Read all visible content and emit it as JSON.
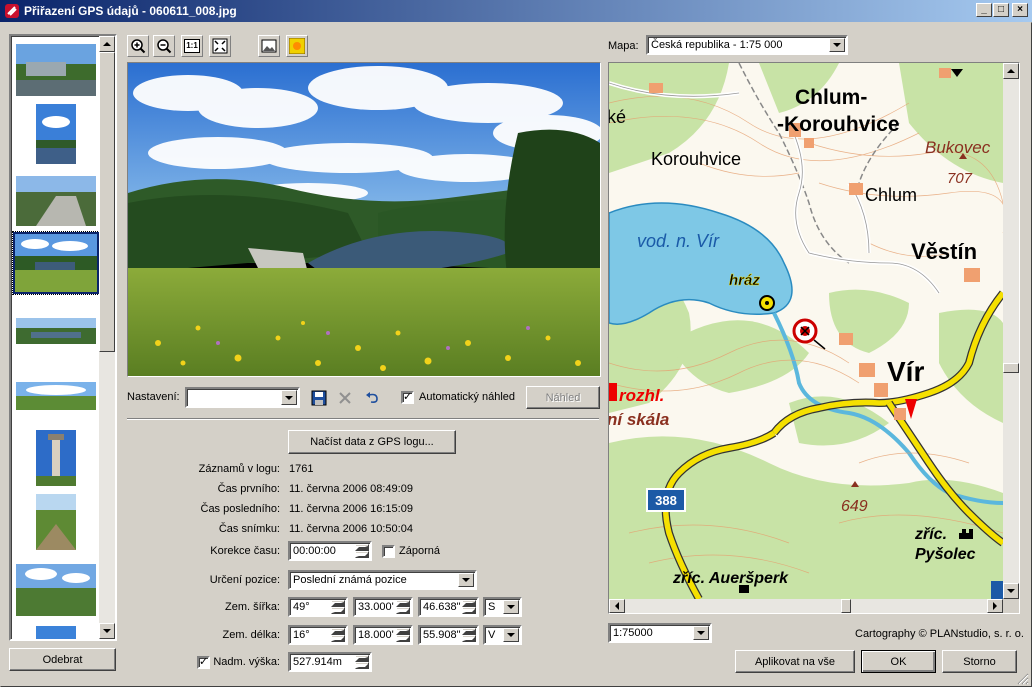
{
  "window": {
    "title": "Přiřazení GPS údajů - 060611_008.jpg",
    "min_label": "_",
    "max_label": "□",
    "close_label": "×"
  },
  "thumbnails": {
    "remove_button": "Odebrat"
  },
  "toolbar": {
    "zoom_in_icon": "zoom-in-icon",
    "zoom_out_icon": "zoom-out-icon",
    "actual_size_label": "1:1",
    "fit_icon": "fit-window-icon",
    "image_icon": "image-view-icon",
    "brightness_icon": "sun-icon"
  },
  "settings": {
    "label": "Nastavení:",
    "value": "",
    "auto_preview_label": "Automatický náhled",
    "auto_preview_checked": true,
    "preview_button": "Náhled"
  },
  "gps": {
    "load_button": "Načíst data z GPS logu...",
    "records_label": "Záznamů v logu:",
    "records_value": "1761",
    "first_label": "Čas prvního:",
    "first_value": "11. června 2006 08:49:09",
    "last_label": "Čas posledního:",
    "last_value": "11. června 2006 16:15:09",
    "shot_label": "Čas snímku:",
    "shot_value": "11. června 2006 10:50:04",
    "correction_label": "Korekce času:",
    "correction_value": "00:00:00",
    "negative_label": "Záporná",
    "negative_checked": false,
    "position_label": "Určení pozice:",
    "position_value": "Poslední známá pozice",
    "lat_label": "Zem. šířka:",
    "lat_deg": "49°",
    "lat_min": "33.000'",
    "lat_sec": "46.638\"",
    "lat_dir": "S",
    "lon_label": "Zem. délka:",
    "lon_deg": "16°",
    "lon_min": "18.000'",
    "lon_sec": "55.908\"",
    "lon_dir": "V",
    "alt_label": "Nadm. výška:",
    "alt_checked": true,
    "alt_value": "527.914m"
  },
  "map": {
    "label": "Mapa:",
    "map_value": "Česká republika - 1:75 000",
    "scale_value": "1:75000",
    "copyright": "Cartography © PLANstudio, s. r. o.",
    "labels": {
      "chlum_korouhvice_1": "Chlum-",
      "chlum_korouhvice_2": "-Korouhvice",
      "korouhvice": "Korouhvice",
      "bukovec": "Bukovec",
      "bukovec_height": "707",
      "chlum": "Chlum",
      "vestin": "Věstín",
      "reservoir": "vod. n. Vír",
      "dam": "hráz",
      "vir": "Vír",
      "rozhl": "rozhl.",
      "skala": "ní skála",
      "road": "388",
      "hill": "649",
      "pysolec_1": "zříc.",
      "pysolec_2": "Pyšolec",
      "auersperk": "zříc. Aueršperk",
      "ke": "ké"
    }
  },
  "buttons": {
    "apply_all": "Aplikovat na vše",
    "ok": "OK",
    "cancel": "Storno"
  }
}
